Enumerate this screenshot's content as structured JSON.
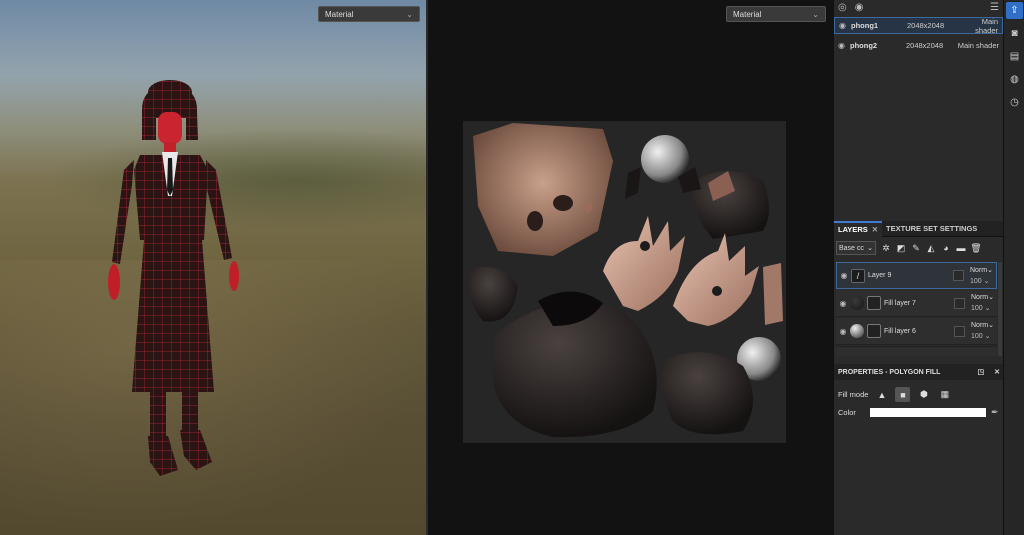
{
  "viewport3d": {
    "material_dropdown": "Material"
  },
  "viewport2d": {
    "material_dropdown": "Material"
  },
  "texture_sets": [
    {
      "name": "phong1",
      "resolution": "2048x2048",
      "shader": "Main shader",
      "selected": true
    },
    {
      "name": "phong2",
      "resolution": "2048x2048",
      "shader": "Main shader",
      "selected": false
    }
  ],
  "tabs": {
    "layers": "LAYERS",
    "texture_set_settings": "TEXTURE SET SETTINGS"
  },
  "layers_toolbar": {
    "channel": "Base cc"
  },
  "layers": [
    {
      "name": "Layer 9",
      "blend": "Norm",
      "opacity": "100",
      "selected": true
    },
    {
      "name": "Fill layer 7",
      "blend": "Norm",
      "opacity": "100",
      "selected": false
    },
    {
      "name": "Fill layer 6",
      "blend": "Norm",
      "opacity": "100",
      "selected": false
    }
  ],
  "properties": {
    "title": "PROPERTIES - POLYGON FILL",
    "fill_mode_label": "Fill mode",
    "color_label": "Color",
    "color_value": "#ffffff"
  },
  "colors": {
    "accent": "#2f6fc7",
    "selected_border": "#3d6a9c"
  }
}
